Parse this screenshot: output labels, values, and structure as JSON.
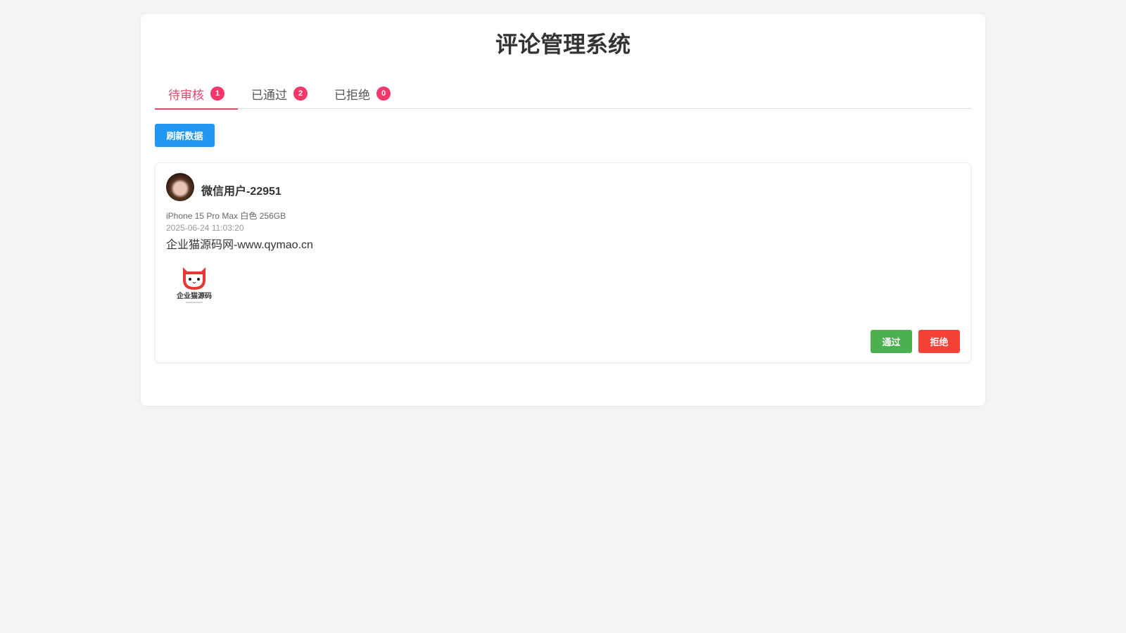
{
  "title": "评论管理系统",
  "tabs": [
    {
      "label": "待审核",
      "count": "1"
    },
    {
      "label": "已通过",
      "count": "2"
    },
    {
      "label": "已拒绝",
      "count": "0"
    }
  ],
  "refresh_label": "刷新数据",
  "comment": {
    "user": "微信用户-22951",
    "product": "iPhone 15 Pro Max 白色 256GB",
    "time": "2025-06-24 11:03:20",
    "content": "企业猫源码网-www.qymao.cn",
    "image_logo_text": "企业猫源码",
    "approve": "通过",
    "reject": "拒绝"
  }
}
